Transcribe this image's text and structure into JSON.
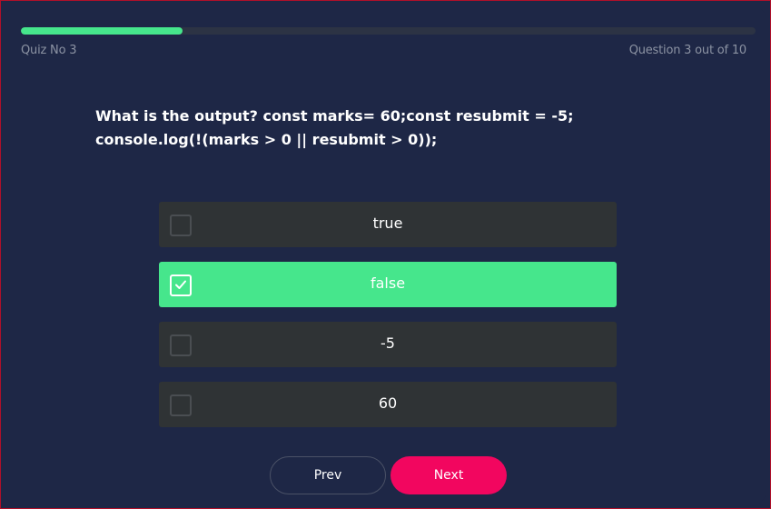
{
  "quiz": {
    "title": "Quiz No 3",
    "counter": "Question 3 out of 10",
    "progress_fraction": 0.22
  },
  "question": {
    "text": "What is the output? const marks= 60;const resubmit = -5; console.log(!(marks > 0 || resubmit > 0));"
  },
  "options": [
    {
      "label": "true",
      "selected": false
    },
    {
      "label": "false",
      "selected": true
    },
    {
      "label": "-5",
      "selected": false
    },
    {
      "label": "60",
      "selected": false
    }
  ],
  "nav": {
    "prev_label": "Prev",
    "next_label": "Next"
  },
  "colors": {
    "background": "#1e2746",
    "accent_green": "#46e68c",
    "accent_pink": "#f2065f",
    "option_bg": "#2f3335"
  }
}
